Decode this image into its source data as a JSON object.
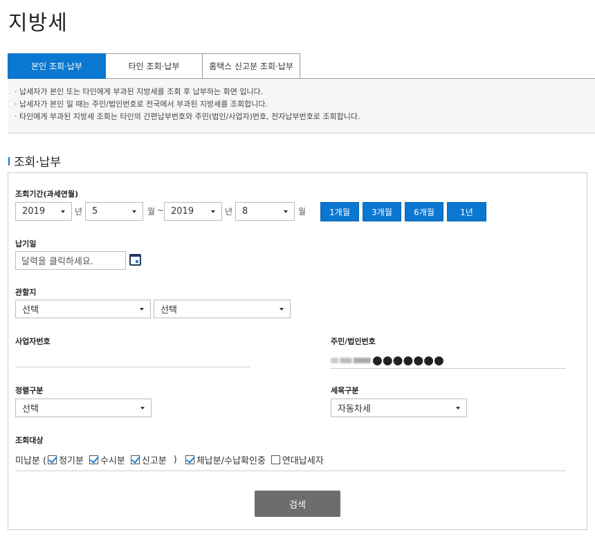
{
  "page_title": "지방세",
  "tabs": [
    {
      "label": "본인 조회·납부",
      "active": true
    },
    {
      "label": "타인 조회·납부",
      "active": false
    },
    {
      "label": "홈택스 신고분 조회·납부",
      "active": false
    }
  ],
  "info_lines": [
    "· 납세자가 본인 또는 타인에게 부과된 지방세를 조회 후 납부하는 화면 입니다.",
    "· 납세자가 본인 일 때는 주민/법인번호로 전국에서 부과된 지방세를 조회합니다.",
    "· 타인에게 부과된 지방세 조회는 타인의 간편납부번호와 주민(법인/사업자)번호, 전자납부번호로 조회합니다."
  ],
  "section_title": "조회·납부",
  "period": {
    "label": "조회기간(과세연월)",
    "from_year": "2019",
    "year_unit": "년",
    "from_month": "5",
    "month_unit": "월",
    "tilde": "~",
    "to_year": "2019",
    "to_month": "8",
    "buttons": [
      "1개월",
      "3개월",
      "6개월",
      "1년"
    ]
  },
  "due_date": {
    "label": "납기일",
    "placeholder": "달력을 클릭하세요."
  },
  "jurisdiction": {
    "label": "관할지",
    "select1": "선택",
    "select2": "선택"
  },
  "business_no": {
    "label": "사업자번호",
    "value": ""
  },
  "resident_no": {
    "label": "주민/법인번호",
    "masked": "●●●●●●●"
  },
  "classification": {
    "label": "정렬구분",
    "value": "선택"
  },
  "tax_item": {
    "label": "세목구분",
    "value": "자동차세"
  },
  "target": {
    "label": "조회대상",
    "prefix": "미납분 (",
    "suffix": ")",
    "options": [
      {
        "label": "정기분",
        "checked": true
      },
      {
        "label": "수시분",
        "checked": true
      },
      {
        "label": "신고분",
        "checked": true
      },
      {
        "label": "체납분/수납확인중",
        "checked": true
      },
      {
        "label": "연대납세자",
        "checked": false
      }
    ]
  },
  "search_button": "검색"
}
